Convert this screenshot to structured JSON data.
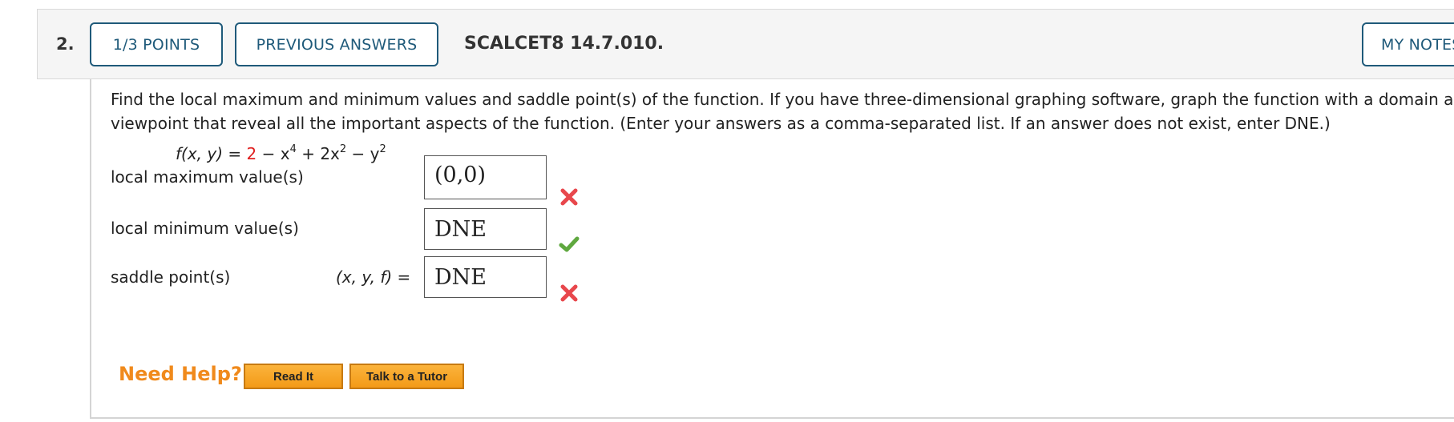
{
  "header": {
    "question_number": "2.",
    "points_label": "1/3 POINTS",
    "previous_answers_label": "PREVIOUS ANSWERS",
    "question_id": "SCALCET8 14.7.010.",
    "my_notes_label": "MY NOTES"
  },
  "question": {
    "text_line1": "Find the local maximum and minimum values and saddle point(s) of the function. If you have three-dimensional graphing software, graph the function with a domain and",
    "text_line2": "viewpoint that reveal all the important aspects of the function. (Enter your answers as a comma-separated list. If an answer does not exist, enter DNE.)",
    "formula": {
      "lhs": "f(x, y)",
      "equals": " = ",
      "constant": "2",
      "rest_1": " − x",
      "exp_1": "4",
      "rest_2": " + 2x",
      "exp_2": "2",
      "rest_3": " − y",
      "exp_3": "2"
    }
  },
  "answers": [
    {
      "label": "local maximum value(s)",
      "prefix": "",
      "value": "(0,0)",
      "status": "incorrect"
    },
    {
      "label": "local minimum value(s)",
      "prefix": "",
      "value": "DNE",
      "status": "correct"
    },
    {
      "label": "saddle point(s)",
      "prefix": "(x, y, f) =",
      "value": "DNE",
      "status": "incorrect"
    }
  ],
  "help": {
    "title": "Need Help?",
    "read_it_label": "Read It",
    "tutor_label": "Talk to a Tutor"
  },
  "colors": {
    "accent": "#1f5a7a",
    "incorrect": "#e8474c",
    "correct": "#5fa83f",
    "help_orange": "#f08a1c"
  },
  "icons": {
    "incorrect": "x-mark-icon",
    "correct": "checkmark-icon"
  }
}
